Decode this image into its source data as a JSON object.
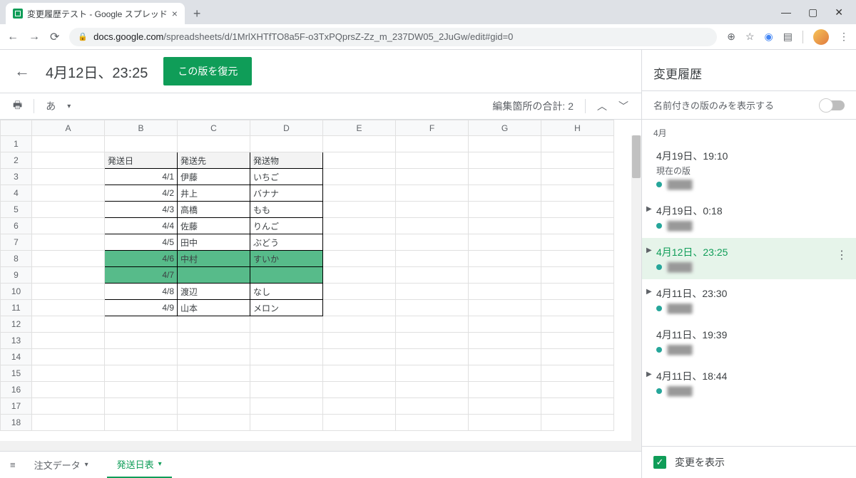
{
  "browser": {
    "tab_title": "変更履歴テスト - Google スプレッド",
    "url_host": "docs.google.com",
    "url_path": "/spreadsheets/d/1MrlXHTfTO8a5F-o3TxPQprsZ-Zz_m_237DW05_2JuGw/edit#gid=0"
  },
  "header": {
    "version_label": "4月12日、23:25",
    "restore_label": "この版を復元"
  },
  "toolbar": {
    "ime_label": "あ",
    "edit_count_label": "編集箇所の合計: 2"
  },
  "columns": [
    "A",
    "B",
    "C",
    "D",
    "E",
    "F",
    "G",
    "H"
  ],
  "rows": [
    1,
    2,
    3,
    4,
    5,
    6,
    7,
    8,
    9,
    10,
    11,
    12,
    13,
    14,
    15,
    16,
    17,
    18
  ],
  "table": {
    "headers": [
      "発送日",
      "発送先",
      "発送物"
    ],
    "rows": [
      {
        "date": "4/1",
        "to": "伊藤",
        "item": "いちご",
        "hl": false
      },
      {
        "date": "4/2",
        "to": "井上",
        "item": "バナナ",
        "hl": false
      },
      {
        "date": "4/3",
        "to": "高橋",
        "item": "もも",
        "hl": false
      },
      {
        "date": "4/4",
        "to": "佐藤",
        "item": "りんご",
        "hl": false
      },
      {
        "date": "4/5",
        "to": "田中",
        "item": "ぶどう",
        "hl": false
      },
      {
        "date": "4/6",
        "to": "中村",
        "item": "すいか",
        "hl": true
      },
      {
        "date": "4/7",
        "to": "",
        "item": "",
        "hl": true
      },
      {
        "date": "4/8",
        "to": "渡辺",
        "item": "なし",
        "hl": false
      },
      {
        "date": "4/9",
        "to": "山本",
        "item": "メロン",
        "hl": false
      }
    ]
  },
  "sheet_tabs": {
    "tab1": "注文データ",
    "tab2": "発送日表"
  },
  "sidebar": {
    "title": "変更履歴",
    "named_only_label": "名前付きの版のみを表示する",
    "month": "4月",
    "versions": [
      {
        "time": "4月19日、19:10",
        "sub": "現在の版",
        "editor": "████",
        "caret": false,
        "selected": false
      },
      {
        "time": "4月19日、0:18",
        "sub": "",
        "editor": "████",
        "caret": true,
        "selected": false
      },
      {
        "time": "4月12日、23:25",
        "sub": "",
        "editor": "████",
        "caret": true,
        "selected": true
      },
      {
        "time": "4月11日、23:30",
        "sub": "",
        "editor": "████",
        "caret": true,
        "selected": false
      },
      {
        "time": "4月11日、19:39",
        "sub": "",
        "editor": "████",
        "caret": false,
        "selected": false
      },
      {
        "time": "4月11日、18:44",
        "sub": "",
        "editor": "████",
        "caret": true,
        "selected": false
      }
    ],
    "show_changes_label": "変更を表示"
  }
}
